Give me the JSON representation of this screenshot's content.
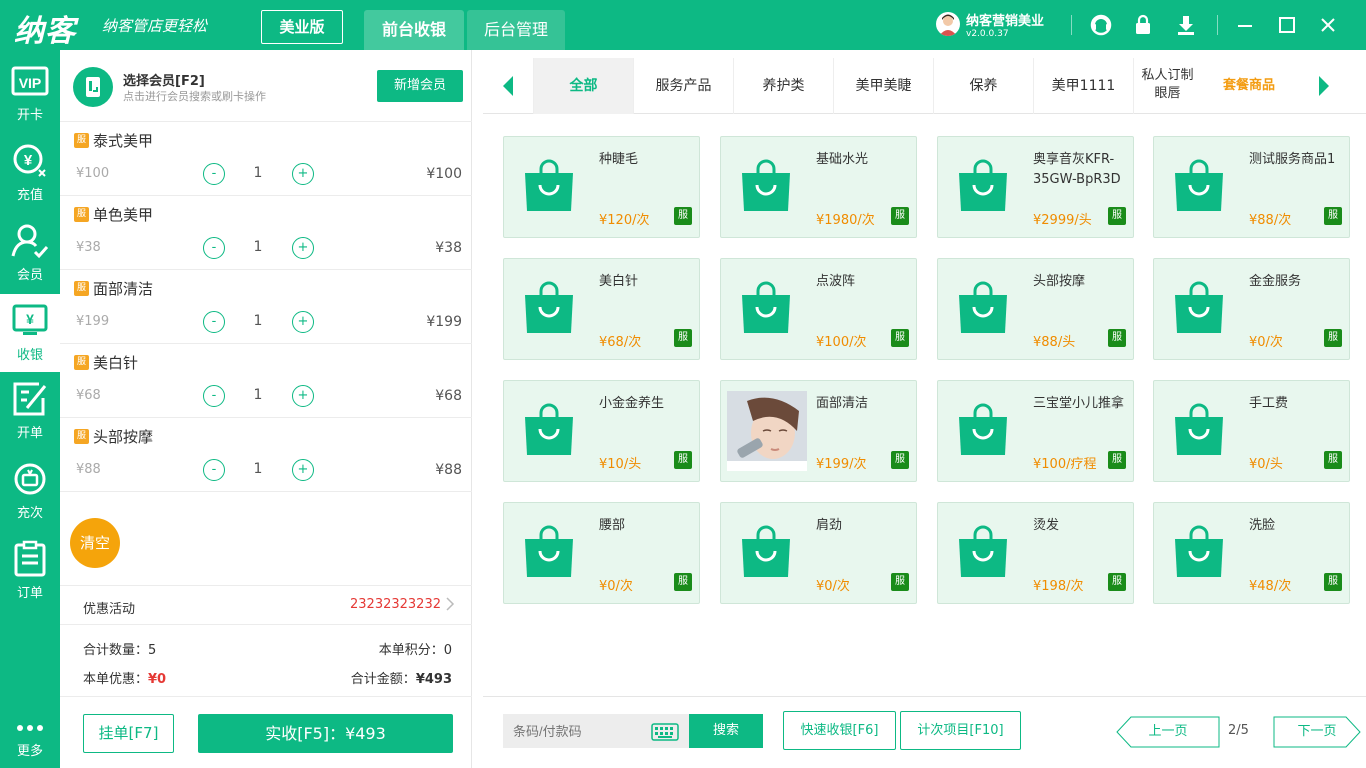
{
  "app": {
    "logo": "纳客",
    "slogan": "纳客管店更轻松",
    "edition": "美业版"
  },
  "top_tabs": [
    {
      "label": "前台收银"
    },
    {
      "label": "后台管理"
    }
  ],
  "user": {
    "name": "纳客营销美业",
    "version": "v2.0.0.37"
  },
  "top_icons": [
    "support-icon",
    "lock-icon",
    "download-icon",
    "minimize-icon",
    "maximize-icon",
    "close-icon"
  ],
  "sidebar": {
    "items": [
      {
        "label": "开卡",
        "icon": "vip-card-icon"
      },
      {
        "label": "充值",
        "icon": "yen-recharge-icon"
      },
      {
        "label": "会员",
        "icon": "member-icon"
      },
      {
        "label": "收银",
        "icon": "cashier-icon"
      },
      {
        "label": "开单",
        "icon": "edit-order-icon"
      },
      {
        "label": "充次",
        "icon": "recharge-times-icon"
      },
      {
        "label": "订单",
        "icon": "order-list-icon"
      },
      {
        "label": "更多",
        "icon": "more-icon"
      }
    ]
  },
  "member": {
    "title": "选择会员[F2]",
    "subtitle": "点击进行会员搜索或刷卡操作",
    "add_button": "新增会员"
  },
  "cart": {
    "tag": "服",
    "items": [
      {
        "name": "泰式美甲",
        "unit_price": "¥100",
        "qty": "1",
        "total": "¥100"
      },
      {
        "name": "单色美甲",
        "unit_price": "¥38",
        "qty": "1",
        "total": "¥38"
      },
      {
        "name": "面部清洁",
        "unit_price": "¥199",
        "qty": "1",
        "total": "¥199"
      },
      {
        "name": "美白针",
        "unit_price": "¥68",
        "qty": "1",
        "total": "¥68"
      },
      {
        "name": "头部按摩",
        "unit_price": "¥88",
        "qty": "1",
        "total": "¥88"
      }
    ],
    "minus": "-",
    "plus": "+",
    "clear": "清空"
  },
  "promo": {
    "label": "优惠活动",
    "value": "23232323232"
  },
  "summary": {
    "count_label": "合计数量：",
    "count": "5",
    "points_label": "本单积分：",
    "points": "0",
    "discount_label": "本单优惠：",
    "discount": "¥0",
    "total_label": "合计金额：",
    "total": "¥493"
  },
  "actions": {
    "hang": "挂单[F7]",
    "pay": "实收[F5]：¥493"
  },
  "categories": [
    {
      "label": "全部"
    },
    {
      "label": "服务产品"
    },
    {
      "label": "养护类"
    },
    {
      "label": "美甲美睫"
    },
    {
      "label": "保养"
    },
    {
      "label": "美甲1111"
    },
    {
      "label": "私人订制眼唇"
    },
    {
      "label": "套餐商品"
    }
  ],
  "products": [
    {
      "name": "种睫毛",
      "price": "¥120/次"
    },
    {
      "name": "基础水光",
      "price": "¥1980/次"
    },
    {
      "name": "奥享音灰KFR-35GW-BpR3D",
      "price": "¥2999/头"
    },
    {
      "name": "测试服务商品1",
      "price": "¥88/次"
    },
    {
      "name": "美白针",
      "price": "¥68/次"
    },
    {
      "name": "点波阵",
      "price": "¥100/次"
    },
    {
      "name": "头部按摩",
      "price": "¥88/头"
    },
    {
      "name": "金金服务",
      "price": "¥0/次"
    },
    {
      "name": "小金金养生",
      "price": "¥10/头"
    },
    {
      "name": "面部清洁",
      "price": "¥199/次"
    },
    {
      "name": "三宝堂小儿推拿",
      "price": "¥100/疗程"
    },
    {
      "name": "手工费",
      "price": "¥0/头"
    },
    {
      "name": "腰部",
      "price": "¥0/次"
    },
    {
      "name": "肩劲",
      "price": "¥0/次"
    },
    {
      "name": "烫发",
      "price": "¥198/次"
    },
    {
      "name": "洗脸",
      "price": "¥48/次"
    }
  ],
  "product_tag": "服",
  "bottom_bar": {
    "barcode_placeholder": "条码/付款码",
    "search": "搜索",
    "quick_cash": "快速收银[F6]",
    "count_item": "计次项目[F10]",
    "prev": "上一页",
    "page": "2/5",
    "next": "下一页"
  },
  "colors": {
    "primary": "#0db984",
    "price": "#f08c00",
    "tag_service": "#1a8c1a",
    "cart_tag": "#f5a623",
    "danger": "#e53935",
    "clear": "#f5a40b"
  }
}
